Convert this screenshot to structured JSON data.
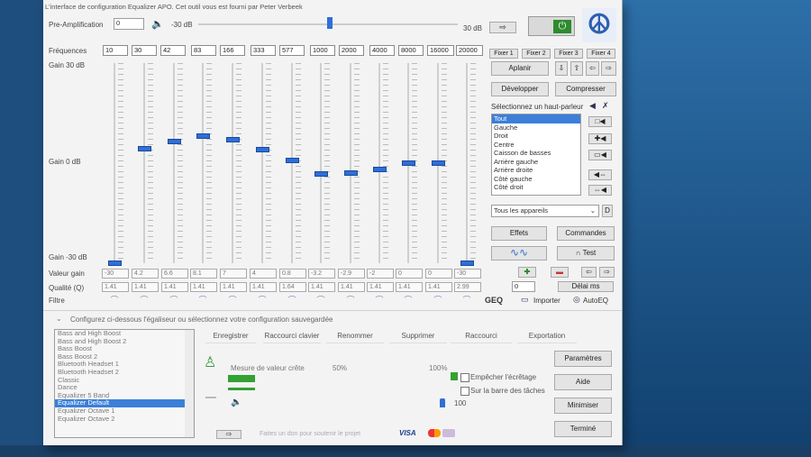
{
  "window_title": "L'interface de configuration Equalizer APO. Cet outil vous est fourni par Peter Verbeek",
  "preamp": {
    "label": "Pre-Amplification",
    "value": "0",
    "min_label": "-30 dB",
    "max_label": "30 dB"
  },
  "frequencies_label": "Fréquences",
  "frequencies": [
    "10",
    "30",
    "42",
    "83",
    "166",
    "333",
    "577",
    "1000",
    "2000",
    "4000",
    "8000",
    "16000",
    "20000"
  ],
  "gain_top_label": "Gain 30 dB",
  "gain_mid_label": "Gain 0 dB",
  "gain_bottom_label": "Gain -30 dB",
  "gain_label": "Valeur gain",
  "gains": [
    "-30",
    "4.2",
    "6.6",
    "8.1",
    "7",
    "4",
    "0.8",
    "-3.2",
    "-2.9",
    "-2",
    "0",
    "0",
    "-30"
  ],
  "quality_label": "Qualité (Q)",
  "qualities": [
    "1.41",
    "1.41",
    "1.41",
    "1.41",
    "1.41",
    "1.41",
    "1.64",
    "1.41",
    "1.41",
    "1.41",
    "1.41",
    "1.41",
    "2.99"
  ],
  "filter_label": "Filtre",
  "fix_buttons": [
    "Fixer 1",
    "Fixer 2",
    "Fixer 3",
    "Fixer 4"
  ],
  "flatten_label": "Aplanir",
  "expand_label": "Développer",
  "compress_label": "Compresser",
  "speaker_select_label": "Sélectionnez un haut-parleur",
  "speakers": [
    "Tout",
    "Gauche",
    "Droit",
    "Centre",
    "Caisson de basses",
    "Arrière gauche",
    "Arrière droite",
    "Côté gauche",
    "Côté droit"
  ],
  "device_select": "Tous les appareils",
  "device_btn": "D",
  "effects_label": "Effets",
  "commands_label": "Commandes",
  "test_label": "Test",
  "delay_label": "Délai ms",
  "delay_value": "0",
  "geq_label": "GEQ",
  "import_label": "Importer",
  "autoeq_label": "AutoEQ",
  "config_label": "Configurez ci-dessous l'égaliseur ou sélectionnez votre configuration sauvegardée",
  "presets": [
    "Bass and High Boost",
    "Bass and High Boost 2",
    "Bass Boost",
    "Bass Boost 2",
    "Bluetooth Headset 1",
    "Bluetooth Headset 2",
    "Classic",
    "Dance",
    "Equalizer 5 Band",
    "Equalizer Default",
    "Equalizer Octave 1",
    "Equalizer Octave 2"
  ],
  "selected_preset_index": 9,
  "action_tabs": [
    "Enregistrer",
    "Raccourci clavier",
    "Renommer",
    "Supprimer",
    "Raccourci",
    "Exportation"
  ],
  "peak_label": "Mesure de valeur crête",
  "peak_50": "50%",
  "peak_100": "100%",
  "prevent_clip_label": "Empêcher l'écrêtage",
  "taskbar_label": "Sur la barre des tâches",
  "volume_value": "100",
  "side_buttons": [
    "Paramètres",
    "Aide",
    "Minimiser",
    "Terminé"
  ],
  "donate_text": "Faites un don pour soutenir le projet",
  "payment_label": "VISA",
  "colors": {
    "accent": "#2f6fd6",
    "selected": "#3b7fd8",
    "power": "#2e8b2e",
    "peak_green": "#33a133"
  }
}
